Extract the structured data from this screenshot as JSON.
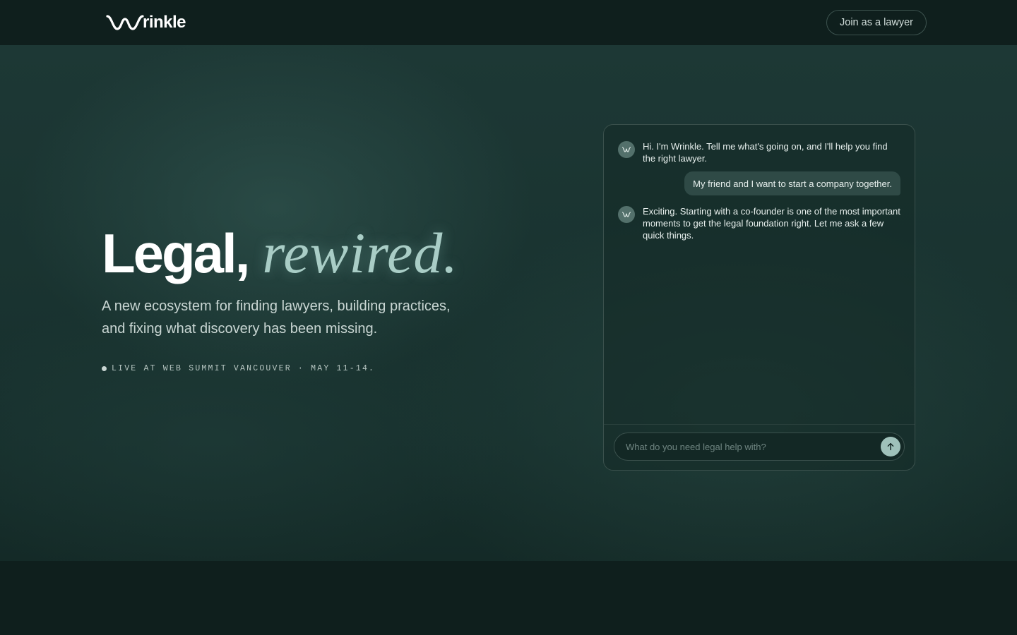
{
  "header": {
    "logo_text": "rinkle",
    "join_label": "Join as a lawyer"
  },
  "hero": {
    "headline_bold": "Legal,",
    "headline_italic": "rewired.",
    "subtitle_line1": "A new ecosystem for finding lawyers, building practices,",
    "subtitle_line2": "and fixing what discovery has been missing.",
    "live_text": "LIVE AT WEB SUMMIT VANCOUVER · MAY 11-14."
  },
  "chat": {
    "messages": [
      {
        "role": "bot",
        "text": "Hi. I'm Wrinkle. Tell me what's going on, and I'll help you find the right lawyer."
      },
      {
        "role": "user",
        "text": "My friend and I want to start a company together."
      },
      {
        "role": "bot",
        "text": "Exciting. Starting with a co-founder is one of the most important moments to get the legal foundation right. Let me ask a few quick things."
      }
    ],
    "input_placeholder": "What do you need legal help with?",
    "input_value": ""
  },
  "colors": {
    "background": "#0f1f1d",
    "hero": "#1a3431",
    "accent": "#a9cdc6",
    "send_button": "#9fc1ba"
  },
  "icons": {
    "logo": "wave-w-icon",
    "bot_avatar": "wave-w-icon",
    "send": "arrow-up-icon"
  }
}
